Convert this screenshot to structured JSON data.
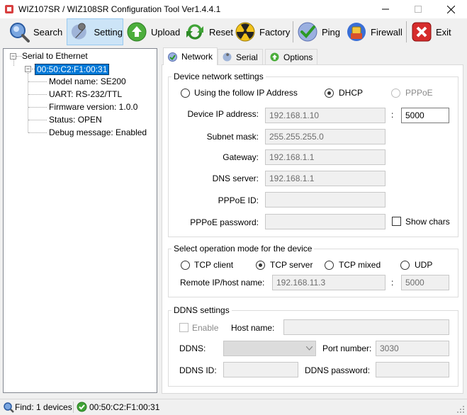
{
  "window": {
    "title": "WIZ107SR / WIZ108SR Configuration Tool Ver1.4.4.1",
    "minimize_glyph": "—",
    "maximize_glyph": "☐",
    "close_glyph": "✕"
  },
  "toolbar": {
    "buttons": [
      {
        "label": "Search",
        "icon": "search-icon"
      },
      {
        "label": "Setting",
        "icon": "wrench-icon"
      },
      {
        "label": "Upload",
        "icon": "upload-arrow-icon"
      },
      {
        "label": "Reset",
        "icon": "reset-arrows-icon"
      },
      {
        "label": "Factory",
        "icon": "factory-radiation-icon"
      },
      {
        "label": "Ping",
        "icon": "ping-check-icon"
      },
      {
        "label": "Firewall",
        "icon": "firewall-shield-icon"
      },
      {
        "label": "Exit",
        "icon": "exit-x-icon"
      }
    ]
  },
  "tree": {
    "root": "Serial to Ethernet",
    "expander_glyph": "−",
    "device": "00:50:C2:F1:00:31",
    "details": [
      "Model name: SE200",
      "UART: RS-232/TTL",
      "Firmware version: 1.0.0",
      "Status: OPEN",
      "Debug message: Enabled"
    ]
  },
  "tabs": [
    {
      "label": "Network",
      "active": true
    },
    {
      "label": "Serial",
      "active": false
    },
    {
      "label": "Options",
      "active": false
    }
  ],
  "network": {
    "group_title": "Device network settings",
    "ip_mode": {
      "static_label": "Using the follow IP Address",
      "dhcp_label": "DHCP",
      "pppoe_label": "PPPoE",
      "selected": "DHCP"
    },
    "device_ip_label": "Device IP address:",
    "device_ip": "192.168.1.10",
    "port_colon": ":",
    "device_port": "5000",
    "subnet_label": "Subnet mask:",
    "subnet": "255.255.255.0",
    "gateway_label": "Gateway:",
    "gateway": "192.168.1.1",
    "dns_label": "DNS server:",
    "dns": "192.168.1.1",
    "pppoe_id_label": "PPPoE ID:",
    "pppoe_id": "",
    "pppoe_pw_label": "PPPoE password:",
    "pppoe_pw": "",
    "show_chars_label": "Show chars"
  },
  "operation": {
    "group_title": "Select operation mode for the device",
    "modes": [
      "TCP client",
      "TCP server",
      "TCP mixed",
      "UDP"
    ],
    "selected": "TCP server",
    "remote_label": "Remote IP/host name:",
    "remote_ip": "192.168.11.3",
    "remote_colon": ":",
    "remote_port": "5000"
  },
  "ddns": {
    "group_title": "DDNS settings",
    "enable_label": "Enable",
    "host_label": "Host name:",
    "host": "",
    "ddns_label": "DDNS:",
    "ddns_value": "",
    "port_label": "Port number:",
    "port": "3030",
    "id_label": "DDNS ID:",
    "id": "",
    "password_label": "DDNS password:",
    "password": ""
  },
  "status": {
    "find_text": "Find: 1 devices",
    "device_text": "00:50:C2:F1:00:31"
  }
}
